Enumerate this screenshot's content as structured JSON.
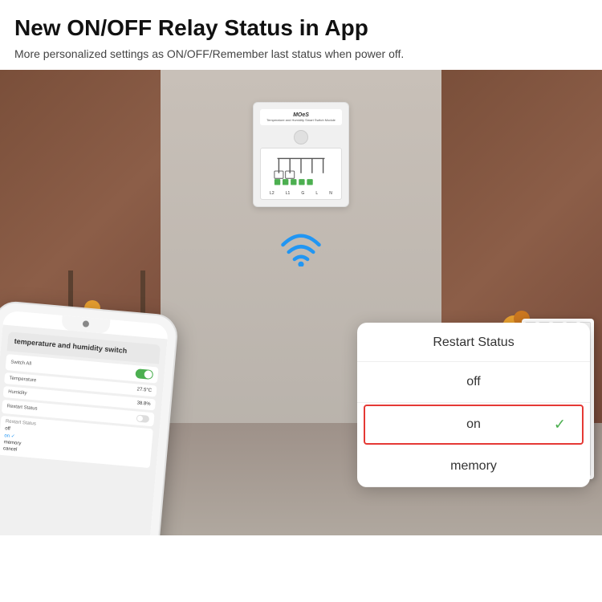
{
  "header": {
    "title": "New ON/OFF Relay Status in App",
    "subtitle": "More personalized settings as ON/OFF/Remember last status when power off."
  },
  "device": {
    "brand": "MOeS",
    "model_label": "Temperature and Humidity\nSmart Switch Module"
  },
  "phone": {
    "app_title": "temperature and humidity\nswitch",
    "switch_all_label": "Switch All",
    "temp_value": "27.5°C",
    "humidity_value": "38.8%",
    "restart_status_label": "Restart Status",
    "restart_items": [
      "off",
      "on",
      "memory",
      "cancel"
    ]
  },
  "popup": {
    "title": "Restart Status",
    "options": [
      {
        "label": "off",
        "selected": false
      },
      {
        "label": "on",
        "selected": true
      },
      {
        "label": "memory",
        "selected": false
      }
    ]
  },
  "icons": {
    "wifi": "wifi-icon",
    "check": "✓"
  }
}
